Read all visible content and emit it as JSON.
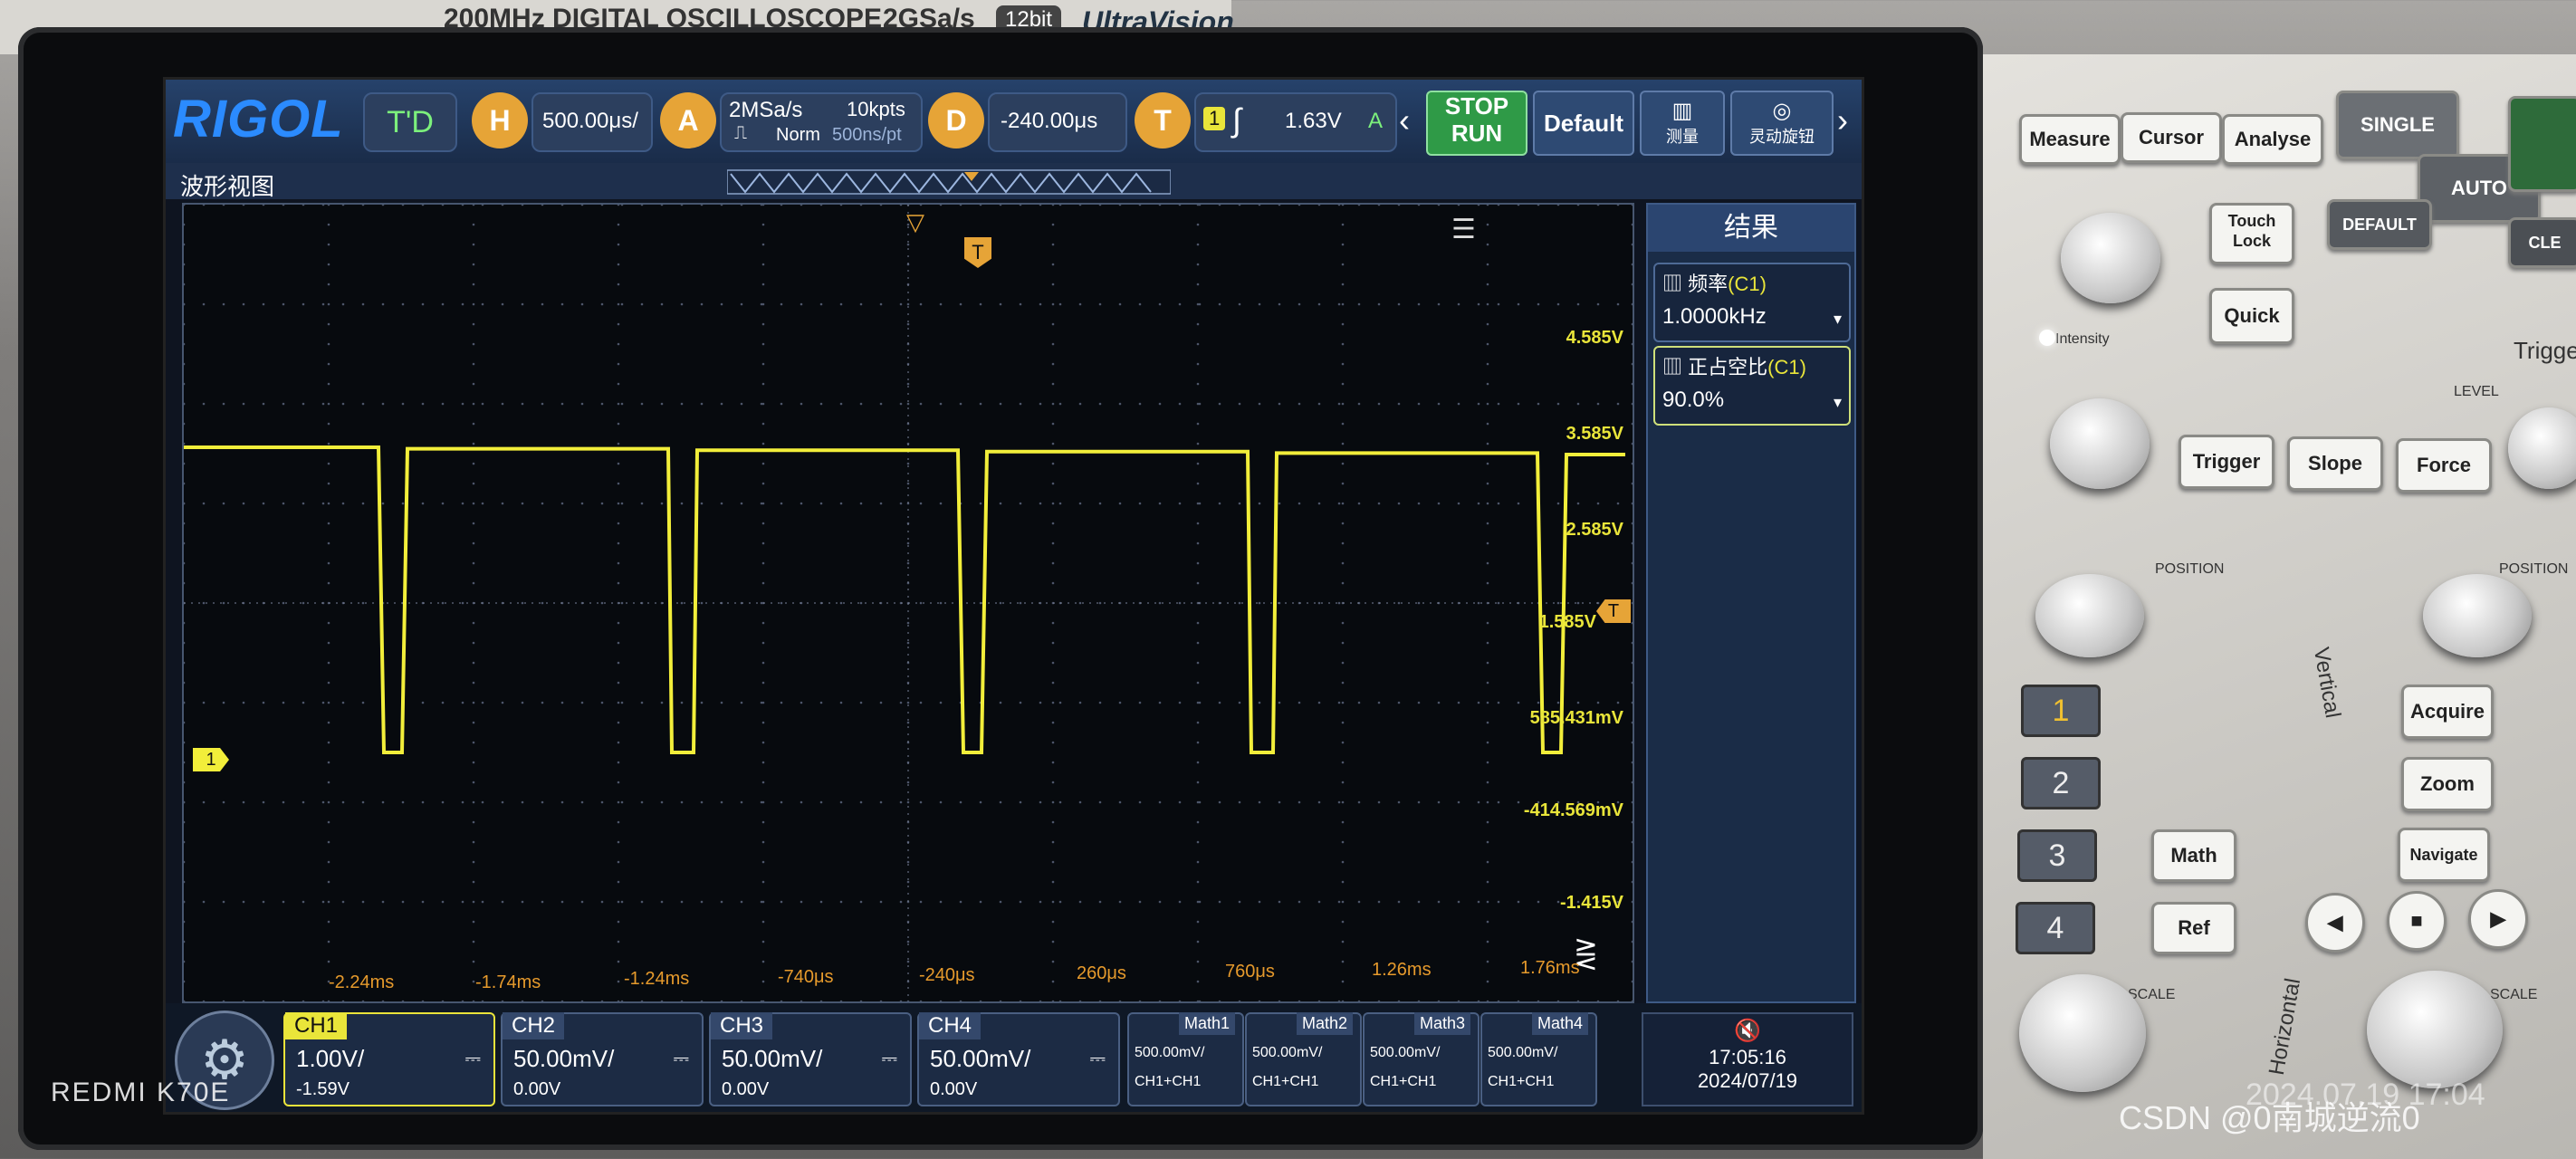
{
  "device": {
    "model_text": "200MHz  DIGITAL OSCILLOSCOPE",
    "sample_rate_label": "2GSa/s",
    "bit_badge": "12bit",
    "ultravision": "UltraVision"
  },
  "toolbar": {
    "logo": "RIGOL",
    "mode": "T'D",
    "h_label": "H",
    "h_value": "500.00μs/",
    "a_label": "A",
    "acq_rate": "2MSa/s",
    "acq_points": "10kpts",
    "acq_mode": "Norm",
    "acq_interval": "500ns/pt",
    "d_label": "D",
    "d_value": "-240.00μs",
    "t_label": "T",
    "trig_channel": "1",
    "trig_level": "1.63V",
    "trig_source": "A",
    "stop_label": "STOP",
    "run_label": "RUN",
    "default_label": "Default",
    "measure_label": "测量",
    "knob_label": "灵动旋钮",
    "view_title": "波形视图"
  },
  "results": {
    "title": "结果",
    "items": [
      {
        "name": "频率",
        "channel": "(C1)",
        "value": "1.0000kHz"
      },
      {
        "name": "正占空比",
        "channel": "(C1)",
        "value": "90.0%"
      }
    ]
  },
  "plot": {
    "ch1_marker": "1",
    "trig_marker": "T",
    "v_labels": [
      "4.585V",
      "3.585V",
      "2.585V",
      "1.585V",
      "585.431mV",
      "-414.569mV",
      "-1.415V"
    ],
    "t_labels": [
      "-2.24ms",
      "-1.74ms",
      "-1.24ms",
      "-740μs",
      "-240μs",
      "260μs",
      "760μs",
      "1.26ms",
      "1.76ms"
    ],
    "waveform": {
      "frequency_khz": 1.0,
      "duty_percent": 90.0,
      "high_v": 3.585,
      "low_v": 0.0
    }
  },
  "channels": [
    {
      "name": "CH1",
      "scale": "1.00V/",
      "offset": "-1.59V",
      "active": true
    },
    {
      "name": "CH2",
      "scale": "50.00mV/",
      "offset": "0.00V",
      "active": false
    },
    {
      "name": "CH3",
      "scale": "50.00mV/",
      "offset": "0.00V",
      "active": false
    },
    {
      "name": "CH4",
      "scale": "50.00mV/",
      "offset": "0.00V",
      "active": false
    }
  ],
  "maths": [
    {
      "name": "Math1",
      "scale": "500.00mV/",
      "expr": "CH1+CH1"
    },
    {
      "name": "Math2",
      "scale": "500.00mV/",
      "expr": "CH1+CH1"
    },
    {
      "name": "Math3",
      "scale": "500.00mV/",
      "expr": "CH1+CH1"
    },
    {
      "name": "Math4",
      "scale": "500.00mV/",
      "expr": "CH1+CH1"
    }
  ],
  "clock": {
    "time": "17:05:16",
    "date": "2024/07/19"
  },
  "panel": {
    "measure": "Measure",
    "cursor": "Cursor",
    "analyse": "Analyse",
    "single": "SINGLE",
    "auto": "AUTO",
    "default": "DEFAULT",
    "clear": "CLE",
    "touch_lock": "Touch Lock",
    "quick": "Quick",
    "intensity": "Intensity",
    "trigger_title": "Trigger",
    "level": "LEVEL",
    "trigger": "Trigger",
    "slope": "Slope",
    "force": "Force",
    "vertical": "Vertical",
    "horizontal": "Horizontal",
    "position": "POSITION",
    "scale": "SCALE",
    "acquire": "Acquire",
    "zoom": "Zoom",
    "navigate": "Navigate",
    "math": "Math",
    "ref": "Ref",
    "ch_buttons": [
      "1",
      "2",
      "3",
      "4"
    ]
  },
  "watermarks": {
    "phone": "REDMI  K70E",
    "csdn": "CSDN @0南城逆流0",
    "stamp": "2024.07.19 17:04"
  }
}
